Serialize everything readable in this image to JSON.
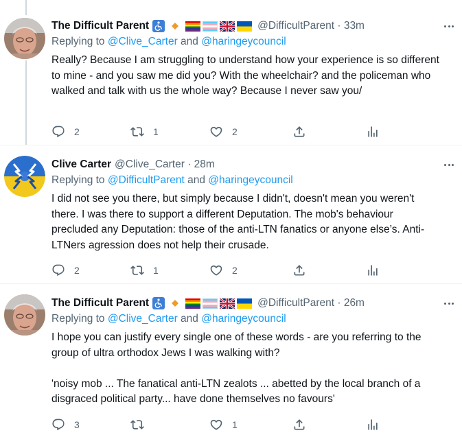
{
  "tweets": [
    {
      "display_name": "The Difficult Parent",
      "handle_time": "@DifficultParent · 33m",
      "badges": [
        "wheelchair-icon",
        "orange-diamond-icon",
        "rainbow-flag-icon",
        "trans-flag-icon",
        "uk-flag-icon",
        "ukraine-flag-icon"
      ],
      "reply_prefix": "Replying to ",
      "mention_1": "@Clive_Carter",
      "reply_and": " and ",
      "mention_2": "@haringeycouncil",
      "text": "Really? Because I am struggling to understand how your experience is so different to mine - and you saw me did you? With the wheelchair? and the policeman who walked and talk with us the whole way? Because I never saw you/",
      "replies": "2",
      "retweets": "1",
      "likes": "2"
    },
    {
      "display_name": "Clive Carter",
      "handle_time": "@Clive_Carter · 28m",
      "badges": [],
      "reply_prefix": "Replying to ",
      "mention_1": "@DifficultParent",
      "reply_and": " and ",
      "mention_2": "@haringeycouncil",
      "text": "I did not see you there, but simply because I didn't, doesn't mean you weren't there. I was there to support a different Deputation. The mob's behaviour precluded any Deputation: those of the anti-LTN fanatics or anyone else’s. Anti-LTNers agression does not help their crusade.",
      "replies": "2",
      "retweets": "1",
      "likes": "2"
    },
    {
      "display_name": "The Difficult Parent",
      "handle_time": "@DifficultParent · 26m",
      "badges": [
        "wheelchair-icon",
        "orange-diamond-icon",
        "rainbow-flag-icon",
        "trans-flag-icon",
        "uk-flag-icon",
        "ukraine-flag-icon"
      ],
      "reply_prefix": "Replying to ",
      "mention_1": "@Clive_Carter",
      "reply_and": " and ",
      "mention_2": "@haringeycouncil",
      "text": "I hope you can justify every single one of these words - are you referring to the group of ultra orthodox Jews I was walking with?\n\n'noisy mob ... The fanatical anti-LTN zealots ... abetted by the local branch of a disgraced political party... have done themselves no favours'",
      "replies": "3",
      "retweets": "",
      "likes": "1"
    }
  ],
  "colors": {
    "text": "#0f1419",
    "secondary": "#536471",
    "link": "#1d9bf0",
    "thread_line": "#cfd9de"
  }
}
